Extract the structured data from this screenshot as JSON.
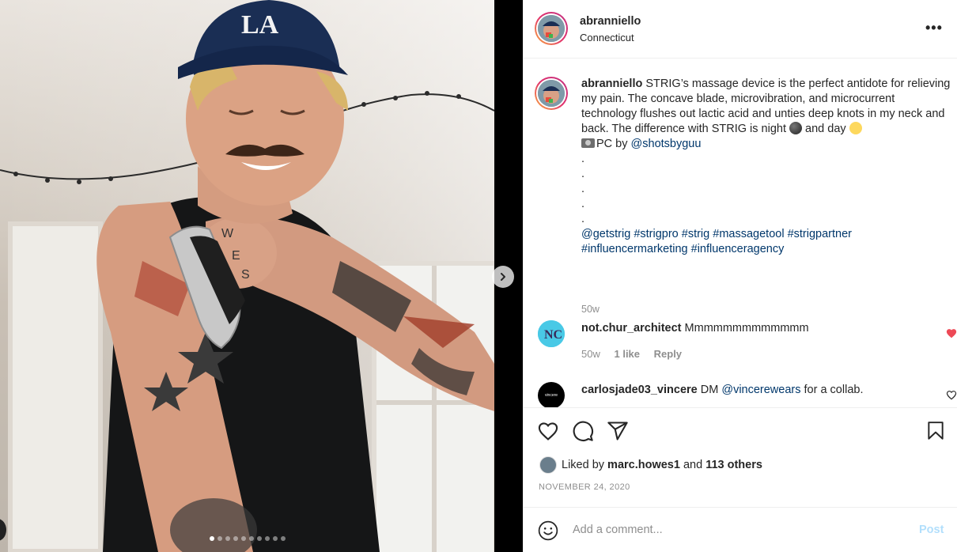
{
  "post": {
    "username": "abranniello",
    "location": "Connecticut",
    "more_label": "•••",
    "caption": {
      "username": "abranniello",
      "text_1": "STRIG’s massage device is the perfect antidote for relieving my pain. The concave blade, microvibration, and microcurrent technology flushes out lactic acid and unties deep knots in my neck and back. The difference with STRIG is night",
      "text_2": "and day",
      "pc_prefix": "PC by",
      "pc_handle": "@shotsbyguu",
      "dots": [
        ".",
        ".",
        ".",
        ".",
        "."
      ],
      "mention": "@getstrig",
      "hashtags": [
        "#strigpro",
        "#strig",
        "#massagetool",
        "#strigpartner",
        "#influencermarketing",
        "#influenceragency"
      ],
      "time": "50w"
    },
    "comments": [
      {
        "username": "not.chur_architect",
        "text": "Mmmmmmmmmmmmm",
        "time": "50w",
        "likes": "1 like",
        "reply": "Reply"
      },
      {
        "username": "carlosjade03_vincere",
        "text_before": "DM",
        "mention": "@vincerewears",
        "text_after": "for a collab.",
        "avatar_text": "vincere"
      }
    ],
    "liked_by": {
      "prefix": "Liked by",
      "user": "marc.howes1",
      "and": "and",
      "others": "113 others"
    },
    "date": "NOVEMBER 24, 2020",
    "add_comment": {
      "placeholder": "Add a comment...",
      "post_label": "Post"
    },
    "carousel": {
      "count": 10,
      "active_index": 0
    }
  },
  "colors": {
    "link": "#00376b",
    "muted": "#8e8e8e",
    "like_red": "#ed4956",
    "post_disabled": "#b2dffc"
  }
}
